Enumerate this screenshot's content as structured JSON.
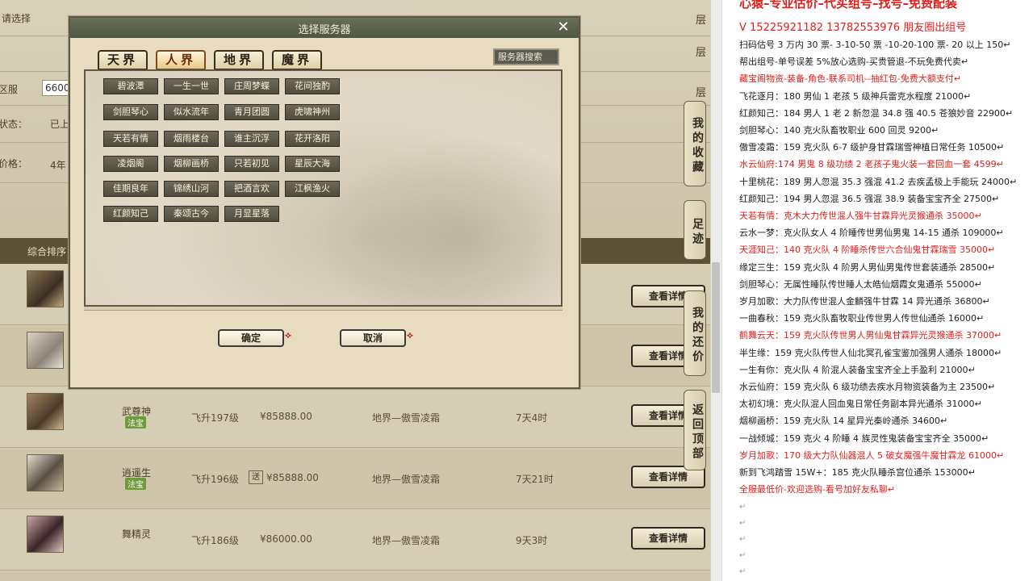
{
  "page": {
    "top_labels": [
      "区服",
      "状态：",
      "价格："
    ],
    "left_top_partial": "请选择",
    "field_value": "6600",
    "status_value": "已上",
    "option_partial": "4年",
    "right_partial_1": "层",
    "right_partial_2": "层",
    "right_partial_3": "层"
  },
  "listing_header": {
    "label": "综合排序"
  },
  "listings": [
    {
      "name": "",
      "badge": "",
      "level": "",
      "price": "",
      "server": "",
      "time": "",
      "detail_label": "查看详情"
    },
    {
      "name": "",
      "badge": "",
      "level": "",
      "price": "",
      "server": "",
      "time": "",
      "detail_label": "查看详情"
    },
    {
      "name": "武尊神",
      "badge": "法宝",
      "level": "飞升197级",
      "price": "¥85888.00",
      "guarantee": "",
      "server": "地界—傲雪凌霜",
      "time": "7天4时",
      "detail_label": "查看详情"
    },
    {
      "name": "逍遥生",
      "badge": "法宝",
      "level": "飞升196级",
      "price": "¥85888.00",
      "guarantee": "送",
      "server": "地界—傲雪凌霜",
      "time": "7天21时",
      "detail_label": "查看详情"
    },
    {
      "name": "舞精灵",
      "badge": "",
      "level": "飞升186级",
      "price": "¥86000.00",
      "guarantee": "",
      "server": "地界—傲雪凌霜",
      "time": "9天3时",
      "detail_label": "查看详情"
    }
  ],
  "side_tabs": [
    {
      "label": "我的收藏"
    },
    {
      "label": "足迹"
    },
    {
      "label": "我的还价"
    },
    {
      "label": "返回顶部"
    }
  ],
  "modal": {
    "title": "选择服务器",
    "close_glyph": "✕",
    "realm_tabs": [
      "天界",
      "人界",
      "地界",
      "魔界"
    ],
    "active_realm": "人界",
    "search_label": "服务器搜索",
    "servers": [
      [
        "碧波潭",
        "一生一世",
        "庄周梦蝶",
        "花间独酌"
      ],
      [
        "剑胆琴心",
        "似水流年",
        "青月团圆",
        "虎啸神州"
      ],
      [
        "天若有情",
        "烟雨楼台",
        "谁主沉浮",
        "花开洛阳"
      ],
      [
        "凌烟阁",
        "烟柳画桥",
        "只若初见",
        "星辰大海"
      ],
      [
        "佳期良年",
        "锦绣山河",
        "把酒言欢",
        "江枫渔火"
      ],
      [
        "红颜知己",
        "秦颂古今",
        "月显星落"
      ]
    ],
    "confirm_label": "确定",
    "cancel_label": "取消"
  },
  "notes": {
    "banner": "心猿–专业估价–代买组号–找号–免费配装",
    "phone": "V 15225921182  13782553976 朋友圈出组号",
    "lines": [
      {
        "text": "扫码估号 3 万内 30 票- 3-10-50 票  -10-20-100 票- 20 以上 150↵",
        "style": "normal"
      },
      {
        "text": "帮出组号-单号误差 5%放心选购-买贵管退-不玩免费代卖↵",
        "style": "normal"
      },
      {
        "text": "藏宝阁物资-装备-角色-联系司机--抽红包-免费大额支付↵",
        "style": "red"
      },
      {
        "text": "飞花逐月：180 男仙 1 老孩 5 级神兵雷克水程度 21000↵",
        "style": "normal"
      },
      {
        "text": "红颜知己：184 男人 1 老 2 新忽混 34.8 强 40.5 苍狼妙音 22900↵",
        "style": "normal"
      },
      {
        "text": "剑胆琴心：140 克火队畜牧职业 600 回灵 9200↵",
        "style": "normal"
      },
      {
        "text": "傲雪凌霜：159 克火队 6-7 级护身甘霖瑞雪神植日常任务 10500↵",
        "style": "normal"
      },
      {
        "text": "水云仙府:174 男鬼 8 级功绩 2 老孩子鬼火装一套回血一套 4599↵",
        "style": "red"
      },
      {
        "text": "十里桃花：189 男人忽混 35.3 强混 41.2 去疾孟极上手能玩 24000↵",
        "style": "normal"
      },
      {
        "text": "红颜知己：194 男人忽混 36.5 强混 38.9 装备宝宝齐全 27500↵",
        "style": "normal"
      },
      {
        "text": "天若有情：克木大力传世混人强牛甘霖异光灵猴通杀 35000↵",
        "style": "red"
      },
      {
        "text": "云水一梦：克火队女人 4 阶睡传世男仙男鬼 14-15 通杀 109000↵",
        "style": "normal"
      },
      {
        "text": "天涯知己：140 克火队 4 阶睡杀传世六合仙鬼甘霖瑞雪 35000↵",
        "style": "red"
      },
      {
        "text": "缘定三生：159 克火队 4 阶男人男仙男鬼传世套装通杀 28500↵",
        "style": "normal"
      },
      {
        "text": "剑胆琴心：无属性睡队传世睡人太皓仙烟霞女鬼通杀 55000↵",
        "style": "normal"
      },
      {
        "text": "岁月加歌：大力队传世混人金麟强牛甘霖 14 异光通杀 36800↵",
        "style": "normal"
      },
      {
        "text": "一曲春秋：159 克火队畜牧职业传世男人传世仙通杀 16000↵",
        "style": "normal"
      },
      {
        "text": "鹤舞云天：159 克火队传世男人男仙鬼甘霖异光灵猴通杀 37000↵",
        "style": "red"
      },
      {
        "text": "半生缘：159 克火队传世人仙北冥孔雀宝鉴加强男人通杀 18000↵",
        "style": "normal"
      },
      {
        "text": "一生有你：克火队 4 阶混人装备宝宝齐全上手盈利 21000↵",
        "style": "normal"
      },
      {
        "text": "水云仙府：159 克火队 6 级功绩去疾水月物资装备为主 23500↵",
        "style": "normal"
      },
      {
        "text": "太初幻境：克火队混人回血鬼日常任务副本异光通杀 31000↵",
        "style": "normal"
      },
      {
        "text": "烟柳画桥：159 克火队 14 星异光秦岭通杀 34600↵",
        "style": "normal"
      },
      {
        "text": "一战倾城：159 克火 4 阶睡 4 族灵性鬼装备宝宝齐全 35000↵",
        "style": "normal"
      },
      {
        "text": "岁月加歌：170 级大力队仙器混人 5 破女魔强牛魔甘霖龙 61000↵",
        "style": "red"
      },
      {
        "text": "新到飞鸿踏雪 15W+：185 克火队睡杀宫位通杀 153000↵",
        "style": "normal"
      },
      {
        "text": "全服最低价-欢迎选购-看号加好友私聊↵",
        "style": "red"
      }
    ],
    "trailing": [
      "↵",
      "↵",
      "↵",
      "↵",
      "↵"
    ]
  },
  "colors": {
    "accent_red": "#e0201c",
    "header_bg": "#5b5236",
    "modal_bar": "#4e5644"
  }
}
